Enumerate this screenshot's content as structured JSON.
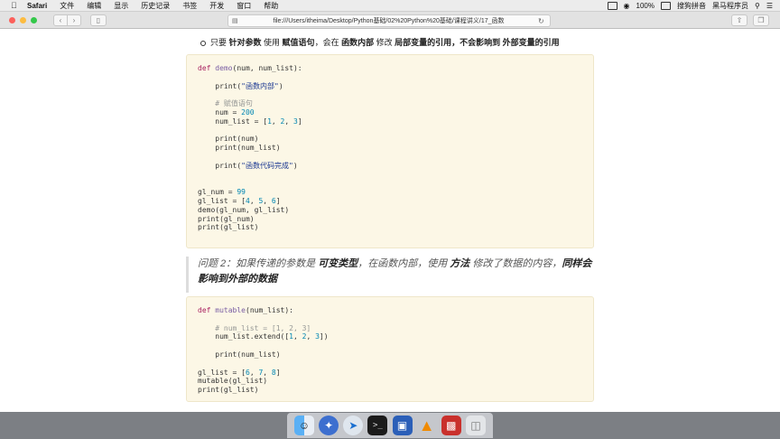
{
  "menubar": {
    "app": "Safari",
    "items": [
      "文件",
      "编辑",
      "显示",
      "历史记录",
      "书签",
      "开发",
      "窗口",
      "帮助"
    ],
    "battery": "100%",
    "input_method": "搜狗拼音",
    "user": "黑马程序员"
  },
  "toolbar": {
    "url": "file:///Users/itheima/Desktop/Python基础/02%20Python%20基础/课程讲义/17_函数"
  },
  "content": {
    "bullet": {
      "p1": "只要 ",
      "b1": "针对参数",
      "p2": " 使用 ",
      "b2": "赋值语句",
      "p3": "，会在 ",
      "b3": "函数内部",
      "p4": " 修改 ",
      "b4": "局部变量的引用，不会影响到 外部变量的引用"
    },
    "code1": [
      "def demo(num, num_list):",
      "",
      "    print(\"函数内部\")",
      "",
      "    # 赋值语句",
      "    num = 200",
      "    num_list = [1, 2, 3]",
      "",
      "    print(num)",
      "    print(num_list)",
      "",
      "    print(\"函数代码完成\")",
      "",
      "",
      "gl_num = 99",
      "gl_list = [4, 5, 6]",
      "demo(gl_num, gl_list)",
      "print(gl_num)",
      "print(gl_list)"
    ],
    "question": {
      "p1": "问题 2：如果传递的参数是 ",
      "b1": "可变类型",
      "p2": "，在函数内部，使用 ",
      "b2": "方法",
      "p3": " 修改了数据的内容，",
      "b3": "同样会影响到外部的数据"
    },
    "code2": [
      "def mutable(num_list):",
      "",
      "    # num_list = [1, 2, 3]",
      "    num_list.extend([1, 2, 3])",
      "",
      "    print(num_list)",
      "",
      "gl_list = [6, 7, 8]",
      "mutable(gl_list)",
      "print(gl_list)"
    ]
  },
  "colors": {
    "code_background": "#fcf7e6",
    "keyword": "#a71d5d",
    "function_name": "#795da3",
    "number": "#0086b3",
    "string": "#183691",
    "comment": "#969896"
  },
  "dock": {
    "icons": [
      "finder-icon",
      "launchpad-icon",
      "safari-icon",
      "terminal-icon",
      "keynote-icon",
      "vlc-icon",
      "parallels-icon",
      "trash-icon"
    ]
  }
}
